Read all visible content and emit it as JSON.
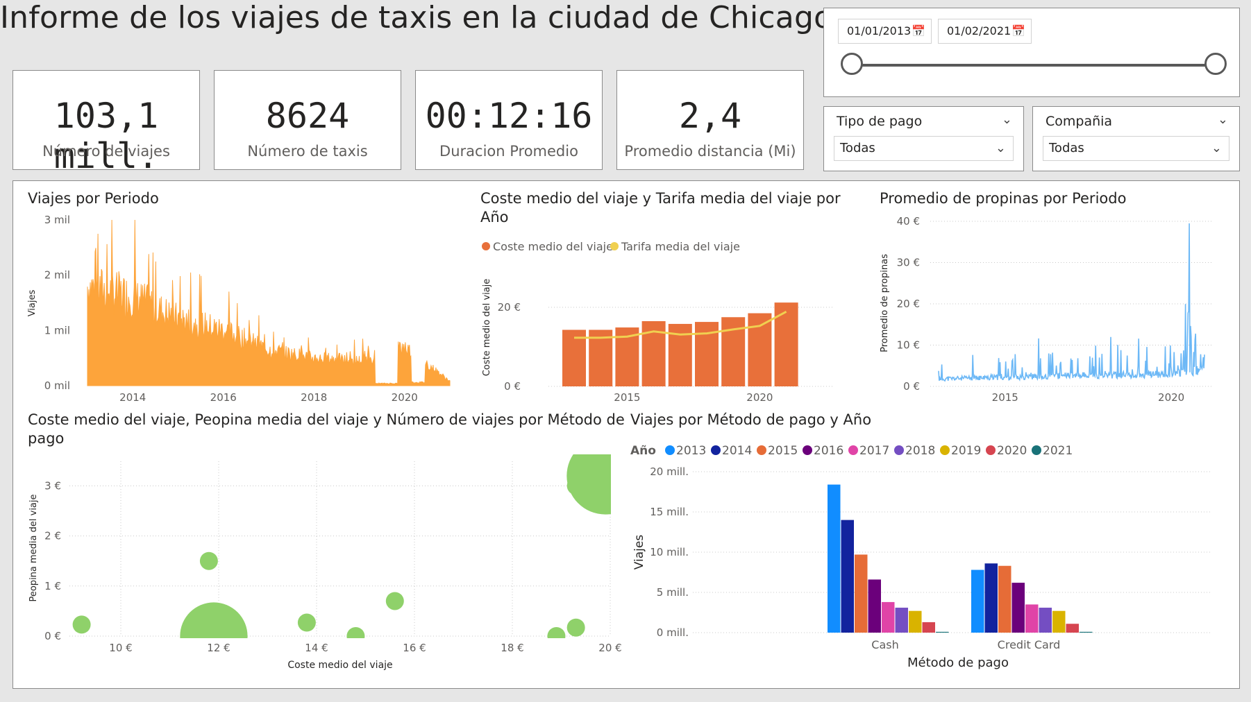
{
  "title": "Informe de los viajes de taxis en la ciudad de Chicago",
  "kpis": [
    {
      "value": "103,1 mill.",
      "label": "Número de viajes"
    },
    {
      "value": "8624",
      "label": "Número de taxis"
    },
    {
      "value": "00:12:16",
      "label": "Duracion Promedio"
    },
    {
      "value": "2,4",
      "label": "Promedio distancia (Mi)"
    }
  ],
  "date_slicer": {
    "start": "01/01/2013",
    "end": "01/02/2021",
    "range": [
      0,
      1
    ]
  },
  "filters": {
    "payment": {
      "title": "Tipo de pago",
      "value": "Todas"
    },
    "company": {
      "title": "Compañia",
      "value": "Todas"
    }
  },
  "colors": {
    "trips": "#FDA43B",
    "coste": "#E8703A",
    "tarifa": "#F0D050",
    "tips": "#6CB8F6",
    "bubble": "#8FD16A"
  },
  "charts": {
    "trips": {
      "title": "Viajes por Periodo",
      "ylabel": "Viajes",
      "yticks": [
        "0 mil",
        "1 mil",
        "2 mil",
        "3 mil"
      ],
      "xticks": [
        "2014",
        "2016",
        "2018",
        "2020"
      ]
    },
    "cost": {
      "title_line1": "Coste medio del viaje y Tarifa media del viaje por",
      "title_line2": "Año",
      "legend": [
        "Coste medio del viaje",
        "Tarifa media del viaje"
      ],
      "ylabel": "Coste medio del viaje",
      "yticks": [
        "0 €",
        "20 €"
      ],
      "xticks": [
        "2015",
        "2020"
      ]
    },
    "tips": {
      "title": "Promedio de propinas por Periodo",
      "ylabel": "Promedio de propinas",
      "yticks": [
        "0 €",
        "10 €",
        "20 €",
        "30 €",
        "40 €"
      ],
      "xticks": [
        "2015",
        "2020"
      ]
    },
    "scatter": {
      "title_line1": "Coste medio del viaje, Peopina media del viaje y Número de viajes por Método de",
      "title_line2": "pago",
      "ylabel": "Peopina media del viaje",
      "xlabel": "Coste medio del viaje",
      "yticks": [
        "0 €",
        "1 €",
        "2 €",
        "3 €"
      ],
      "xticks": [
        "10 €",
        "12 €",
        "14 €",
        "16 €",
        "18 €",
        "20 €"
      ]
    },
    "method": {
      "title": "Viajes por Método de pago y Año",
      "legend_title": "Año",
      "ylabel": "Viajes",
      "xlabel": "Método de pago",
      "yticks": [
        "0 mill.",
        "5 mill.",
        "10 mill.",
        "15 mill.",
        "20 mill."
      ]
    }
  },
  "chart_data": [
    {
      "type": "area",
      "title": "Viajes por Periodo",
      "ylabel": "Viajes",
      "ylim": [
        0,
        3000
      ],
      "x": [
        "2013",
        "2014",
        "2015",
        "2016",
        "2017",
        "2018",
        "2019",
        "2020",
        "2021"
      ],
      "values": [
        1800,
        1600,
        1200,
        1000,
        650,
        500,
        450,
        700,
        80
      ],
      "peak": 3000
    },
    {
      "type": "bar",
      "title": "Coste medio del viaje y Tarifa media del viaje por Año",
      "categories": [
        "2013",
        "2014",
        "2015",
        "2016",
        "2017",
        "2018",
        "2019",
        "2020",
        "2021"
      ],
      "series": [
        {
          "name": "Coste medio del viaje",
          "type": "bar",
          "values": [
            14.3,
            14.3,
            14.9,
            16.5,
            15.8,
            16.3,
            17.5,
            18.5,
            21.2
          ]
        },
        {
          "name": "Tarifa media del viaje",
          "type": "line",
          "values": [
            12.3,
            12.3,
            12.6,
            13.9,
            13.1,
            13.4,
            14.4,
            15.3,
            18.9
          ]
        }
      ],
      "ylabel": "Coste medio del viaje",
      "ylim": [
        0,
        27
      ]
    },
    {
      "type": "line",
      "title": "Promedio de propinas por Periodo",
      "ylabel": "Promedio de propinas",
      "ylim": [
        0,
        40
      ],
      "x": [
        "2013",
        "2014",
        "2015",
        "2016",
        "2017",
        "2018",
        "2019",
        "2020",
        "2021"
      ],
      "values": [
        1.8,
        2.0,
        2.2,
        2.4,
        2.6,
        2.7,
        2.8,
        3.0,
        4.0
      ],
      "peak": 39.5
    },
    {
      "type": "scatter",
      "title": "Coste medio del viaje, Peopina media del viaje y Número de viajes por Método de pago",
      "xlabel": "Coste medio del viaje",
      "ylabel": "Peopina media del viaje",
      "xlim": [
        9,
        20
      ],
      "ylim": [
        0,
        3.4
      ],
      "points": [
        {
          "x": 9.2,
          "y": 0.23,
          "size": 0.3
        },
        {
          "x": 11.8,
          "y": 1.5,
          "size": 0.3
        },
        {
          "x": 11.9,
          "y": 0.0,
          "size": 42.0
        },
        {
          "x": 13.8,
          "y": 0.27,
          "size": 0.3
        },
        {
          "x": 14.8,
          "y": 0.0,
          "size": 0.3
        },
        {
          "x": 15.6,
          "y": 0.7,
          "size": 0.3
        },
        {
          "x": 18.9,
          "y": 0.0,
          "size": 0.3
        },
        {
          "x": 19.3,
          "y": 0.17,
          "size": 0.3
        },
        {
          "x": 19.3,
          "y": 3.0,
          "size": 0.3
        },
        {
          "x": 19.9,
          "y": 3.2,
          "size": 55.0
        }
      ]
    },
    {
      "type": "bar",
      "title": "Viajes por Método de pago y Año",
      "xlabel": "Método de pago",
      "ylabel": "Viajes",
      "ylim": [
        0,
        20
      ],
      "categories": [
        "Cash",
        "Credit Card"
      ],
      "series": [
        {
          "name": "2013",
          "color": "#118DFF",
          "values": [
            18.4,
            7.8
          ]
        },
        {
          "name": "2014",
          "color": "#12239E",
          "values": [
            14.0,
            8.6
          ]
        },
        {
          "name": "2015",
          "color": "#E66C37",
          "values": [
            9.7,
            8.3
          ]
        },
        {
          "name": "2016",
          "color": "#6B007B",
          "values": [
            6.6,
            6.2
          ]
        },
        {
          "name": "2017",
          "color": "#E044A7",
          "values": [
            3.8,
            3.5
          ]
        },
        {
          "name": "2018",
          "color": "#744EC2",
          "values": [
            3.1,
            3.1
          ]
        },
        {
          "name": "2019",
          "color": "#D9B300",
          "values": [
            2.7,
            2.7
          ]
        },
        {
          "name": "2020",
          "color": "#D64550",
          "values": [
            1.3,
            1.1
          ]
        },
        {
          "name": "2021",
          "color": "#197278",
          "values": [
            0.1,
            0.1
          ]
        }
      ]
    }
  ]
}
